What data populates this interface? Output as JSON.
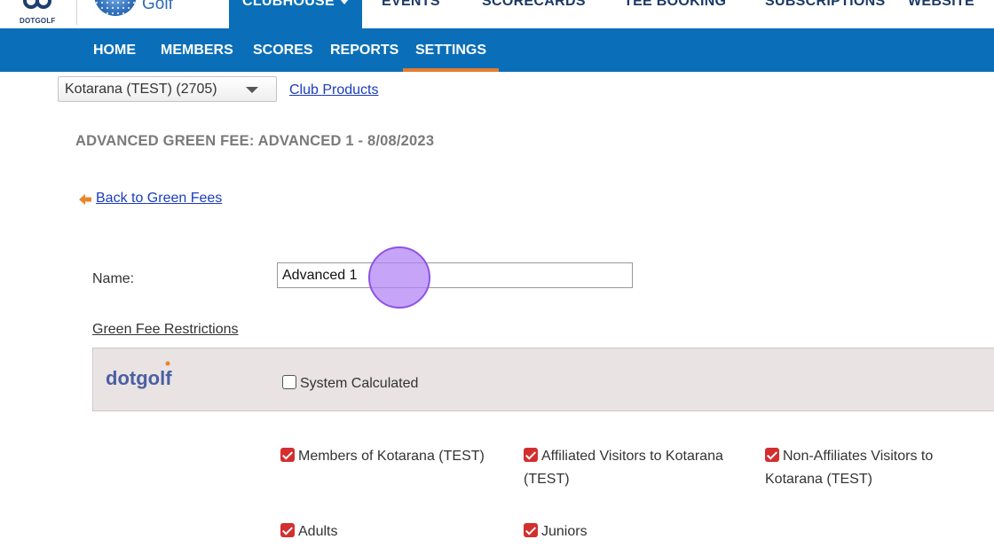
{
  "header": {
    "dotgolf_logo_text": "DOTGOLF",
    "golf_logo_text": "Golf",
    "nav": [
      {
        "label": "CLUBHOUSE",
        "active": true
      },
      {
        "label": "EVENTS"
      },
      {
        "label": "SCORECARDS"
      },
      {
        "label": "TEE BOOKING"
      },
      {
        "label": "SUBSCRIPTIONS"
      },
      {
        "label": "WEBSITE"
      }
    ]
  },
  "subnav": {
    "items": [
      "HOME",
      "MEMBERS",
      "SCORES",
      "REPORTS",
      "SETTINGS"
    ],
    "active": "SETTINGS"
  },
  "club_select": {
    "value": "Kotarana (TEST) (2705)"
  },
  "club_products_link": "Club Products",
  "page_heading": "ADVANCED GREEN FEE: ADVANCED 1 - 8/08/2023",
  "back_link": "Back to Green Fees",
  "form": {
    "name_label": "Name:",
    "name_value": "Advanced 1"
  },
  "restrictions": {
    "title": "Green Fee Restrictions",
    "panel_logo_text": "dotgolf",
    "system_calculated": {
      "label": "System Calculated",
      "checked": false
    },
    "options": [
      {
        "label": "Members of Kotarana (TEST)",
        "checked": true
      },
      {
        "label": "Affiliated Visitors to Kotarana (TEST)",
        "checked": true
      },
      {
        "label": "Non-Affiliates Visitors to Kotarana (TEST)",
        "checked": true
      },
      {
        "label": "Adults",
        "checked": true
      },
      {
        "label": "Juniors",
        "checked": true
      }
    ]
  },
  "colors": {
    "nav_blue": "#0a6fb8",
    "active_underline": "#e87b2c",
    "link_blue": "#1a3dbf",
    "checkbox_red": "#d32f2f",
    "panel_bg": "#e9e3e3",
    "click_marker": "#b082f5"
  }
}
